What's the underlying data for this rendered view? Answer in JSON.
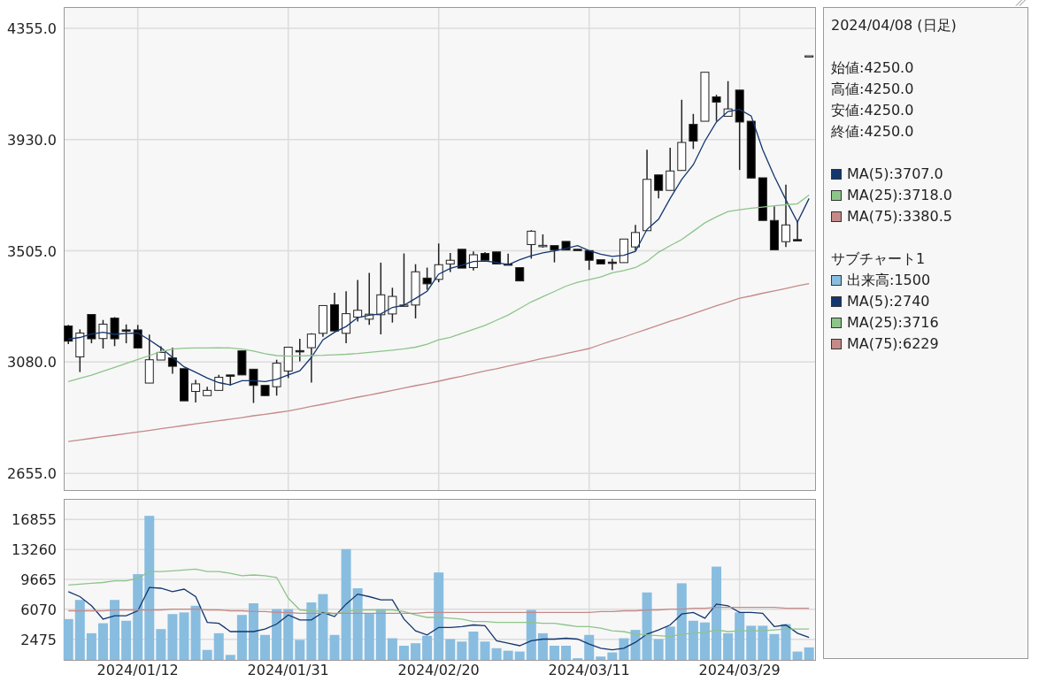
{
  "price_chart": {
    "chart_data": {
      "type": "candlestick",
      "grid": true,
      "ylim": [
        2588,
        4436
      ],
      "yticks": [
        {
          "value": 4355,
          "label": "4355.0"
        },
        {
          "value": 3930,
          "label": "3930.0"
        },
        {
          "value": 3505,
          "label": "3505.0"
        },
        {
          "value": 3080,
          "label": "3080.0"
        },
        {
          "value": 2655,
          "label": "2655.0"
        }
      ],
      "ohlc": [
        [
          3218,
          3222,
          3149,
          3160
        ],
        [
          3100,
          3205,
          3042,
          3191
        ],
        [
          3262,
          3262,
          3152,
          3169
        ],
        [
          3170,
          3241,
          3132,
          3225
        ],
        [
          3248,
          3252,
          3141,
          3169
        ],
        [
          3203,
          3224,
          3152,
          3200
        ],
        [
          3203,
          3222,
          3134,
          3134
        ],
        [
          3000,
          3185,
          3000,
          3089
        ],
        [
          3088,
          3140,
          3088,
          3117
        ],
        [
          3096,
          3135,
          3036,
          3064
        ],
        [
          3055,
          3055,
          2932,
          2932
        ],
        [
          2968,
          3012,
          2926,
          2997
        ],
        [
          2952,
          2986,
          2952,
          2972
        ],
        [
          2972,
          3031,
          2972,
          3022
        ],
        [
          3031,
          3031,
          2991,
          3029
        ],
        [
          3123,
          3123,
          3031,
          3031
        ],
        [
          3053,
          3053,
          2924,
          2991
        ],
        [
          2991,
          2991,
          2952,
          2952
        ],
        [
          2986,
          3089,
          2952,
          3076
        ],
        [
          3046,
          3137,
          3019,
          3137
        ],
        [
          3124,
          3169,
          3083,
          3123
        ],
        [
          3135,
          3190,
          3002,
          3187
        ],
        [
          3190,
          3296,
          3177,
          3296
        ],
        [
          3299,
          3345,
          3199,
          3199
        ],
        [
          3190,
          3351,
          3152,
          3265
        ],
        [
          3252,
          3394,
          3235,
          3278
        ],
        [
          3244,
          3421,
          3222,
          3263
        ],
        [
          3261,
          3460,
          3186,
          3337
        ],
        [
          3264,
          3364,
          3231,
          3331
        ],
        [
          3297,
          3495,
          3295,
          3298
        ],
        [
          3298,
          3454,
          3247,
          3425
        ],
        [
          3401,
          3441,
          3357,
          3379
        ],
        [
          3396,
          3533,
          3385,
          3452
        ],
        [
          3455,
          3497,
          3424,
          3469
        ],
        [
          3511,
          3511,
          3439,
          3439
        ],
        [
          3441,
          3503,
          3430,
          3490
        ],
        [
          3495,
          3500,
          3469,
          3469
        ],
        [
          3501,
          3501,
          3455,
          3455
        ],
        [
          3455,
          3494,
          3454,
          3454
        ],
        [
          3441,
          3441,
          3390,
          3390
        ],
        [
          3529,
          3584,
          3475,
          3580
        ],
        [
          3525,
          3568,
          3517,
          3526
        ],
        [
          3525,
          3525,
          3461,
          3508
        ],
        [
          3541,
          3541,
          3508,
          3508
        ],
        [
          3511,
          3511,
          3510,
          3510
        ],
        [
          3506,
          3506,
          3432,
          3469
        ],
        [
          3471,
          3471,
          3455,
          3455
        ],
        [
          3462,
          3475,
          3432,
          3461
        ],
        [
          3460,
          3550,
          3460,
          3550
        ],
        [
          3520,
          3604,
          3506,
          3575
        ],
        [
          3582,
          3891,
          3582,
          3778
        ],
        [
          3795,
          3795,
          3705,
          3736
        ],
        [
          3736,
          3899,
          3736,
          3810
        ],
        [
          3812,
          4082,
          3812,
          3919
        ],
        [
          3988,
          4028,
          3894,
          3924
        ],
        [
          4000,
          4187,
          4000,
          4187
        ],
        [
          4093,
          4101,
          4001,
          4073
        ],
        [
          4019,
          4153,
          4019,
          4047
        ],
        [
          4119,
          4119,
          3814,
          3997
        ],
        [
          4000,
          4000,
          3783,
          3783
        ],
        [
          3784,
          3784,
          3621,
          3621
        ],
        [
          3621,
          3675,
          3509,
          3509
        ],
        [
          3540,
          3758,
          3520,
          3604
        ],
        [
          3548,
          3615,
          3547,
          3547
        ],
        [
          4250,
          4250,
          4250,
          4250
        ]
      ],
      "series": [
        {
          "type": "line",
          "color": "#13366f",
          "values": [
            3168,
            3174,
            3187,
            3194,
            3186,
            3190,
            3191,
            3165,
            3135,
            3098,
            3062,
            3041,
            3019,
            3002,
            2993,
            3009,
            3009,
            3006,
            3014,
            3031,
            3047,
            3098,
            3165,
            3194,
            3216,
            3250,
            3259,
            3264,
            3289,
            3297,
            3323,
            3351,
            3416,
            3438,
            3450,
            3464,
            3466,
            3461,
            3452,
            3471,
            3486,
            3497,
            3505,
            3514,
            3525,
            3506,
            3492,
            3484,
            3488,
            3503,
            3587,
            3626,
            3705,
            3778,
            3834,
            3924,
            3997,
            4037,
            4045,
            4020,
            3891,
            3790,
            3700,
            3615,
            3705
          ]
        },
        {
          "type": "line",
          "color": "#8ec48a",
          "values": [
            3006,
            3018,
            3030,
            3045,
            3060,
            3075,
            3090,
            3105,
            3120,
            3130,
            3133,
            3134,
            3134,
            3135,
            3134,
            3130,
            3122,
            3112,
            3105,
            3103,
            3104,
            3105,
            3106,
            3108,
            3110,
            3113,
            3117,
            3121,
            3126,
            3131,
            3137,
            3148,
            3165,
            3175,
            3190,
            3205,
            3220,
            3240,
            3260,
            3285,
            3310,
            3330,
            3350,
            3370,
            3385,
            3395,
            3405,
            3421,
            3430,
            3441,
            3465,
            3500,
            3525,
            3548,
            3580,
            3612,
            3635,
            3655,
            3662,
            3668,
            3672,
            3677,
            3681,
            3685,
            3718
          ]
        },
        {
          "type": "line",
          "color": "#c48a88",
          "values": [
            2777,
            2783,
            2789,
            2795,
            2801,
            2807,
            2813,
            2819,
            2826,
            2832,
            2838,
            2844,
            2850,
            2856,
            2862,
            2868,
            2875,
            2881,
            2887,
            2893,
            2902,
            2911,
            2919,
            2928,
            2937,
            2946,
            2954,
            2963,
            2972,
            2981,
            2990,
            2998,
            3007,
            3017,
            3026,
            3036,
            3046,
            3055,
            3065,
            3074,
            3084,
            3094,
            3103,
            3113,
            3122,
            3132,
            3147,
            3162,
            3176,
            3191,
            3206,
            3221,
            3236,
            3250,
            3265,
            3280,
            3295,
            3309,
            3324,
            3333,
            3343,
            3352,
            3361,
            3371,
            3380
          ]
        }
      ]
    }
  },
  "volume_chart": {
    "chart_data": {
      "type": "bar",
      "grid": true,
      "ylim": [
        0,
        19335
      ],
      "categories": [
        null,
        null,
        null,
        null,
        null,
        null,
        "2024/01/12",
        null,
        null,
        null,
        null,
        null,
        null,
        null,
        null,
        null,
        null,
        null,
        null,
        "2024/01/31",
        null,
        null,
        null,
        null,
        null,
        null,
        null,
        null,
        null,
        null,
        null,
        null,
        "2024/02/20",
        null,
        null,
        null,
        null,
        null,
        null,
        null,
        null,
        null,
        null,
        null,
        null,
        "2024/03/11",
        null,
        null,
        null,
        null,
        null,
        null,
        null,
        null,
        null,
        null,
        null,
        null,
        "2024/03/29",
        null,
        null,
        null,
        null,
        null,
        null
      ],
      "yticks": [
        16855,
        13260,
        9665,
        6070,
        2475
      ],
      "series": [
        {
          "type": "bar",
          "color": "#88bde0",
          "values": [
            4900,
            7200,
            3200,
            4400,
            7200,
            4700,
            10300,
            17300,
            3700,
            5500,
            5700,
            6500,
            1200,
            3200,
            600,
            5400,
            6800,
            3000,
            6100,
            6100,
            2400,
            6900,
            7900,
            3000,
            13300,
            8600,
            5600,
            6100,
            2600,
            1700,
            2000,
            2900,
            10500,
            2500,
            2200,
            3400,
            2200,
            1400,
            1100,
            1000,
            6000,
            3200,
            1700,
            1700,
            200,
            3000,
            400,
            900,
            2600,
            3600,
            8100,
            2500,
            4000,
            9200,
            4700,
            4500,
            11200,
            3200,
            5700,
            4100,
            4100,
            3100,
            4300,
            1000,
            1500
          ]
        },
        {
          "type": "line",
          "color": "#13366f",
          "values": [
            8200,
            7600,
            6500,
            4900,
            5300,
            5300,
            5900,
            8700,
            8600,
            8200,
            8500,
            7600,
            4500,
            4400,
            3400,
            3400,
            3400,
            3700,
            4300,
            5400,
            4800,
            4800,
            5700,
            5200,
            6700,
            7900,
            7600,
            7200,
            7200,
            4900,
            3500,
            3000,
            3900,
            3900,
            4000,
            4200,
            4100,
            2300,
            2000,
            1700,
            2300,
            2500,
            2500,
            2600,
            2500,
            1900,
            1400,
            1200,
            1400,
            2100,
            3100,
            3600,
            4200,
            5500,
            5700,
            5000,
            6700,
            6500,
            5700,
            5700,
            5600,
            4000,
            4200,
            3200,
            2700
          ]
        },
        {
          "type": "line",
          "color": "#8ec48a",
          "values": [
            9000,
            9100,
            9200,
            9300,
            9500,
            9500,
            9800,
            10600,
            10600,
            10700,
            10800,
            10900,
            10600,
            10600,
            10400,
            10100,
            10200,
            10100,
            9900,
            7400,
            6000,
            5900,
            5800,
            5500,
            5800,
            6000,
            6000,
            6000,
            6000,
            5800,
            5400,
            5100,
            5100,
            5000,
            4900,
            4600,
            4600,
            4500,
            4500,
            4500,
            4500,
            4400,
            4400,
            4200,
            4000,
            4000,
            3800,
            3500,
            3400,
            3100,
            3000,
            2900,
            2800,
            3100,
            3200,
            3300,
            3600,
            3400,
            3500,
            3500,
            3500,
            3600,
            3700,
            3700,
            3700
          ]
        },
        {
          "type": "line",
          "color": "#c48a88",
          "values": [
            5900,
            5900,
            5900,
            5900,
            6000,
            6000,
            6000,
            6000,
            6000,
            6100,
            6100,
            6100,
            6000,
            6000,
            5900,
            5900,
            5800,
            5800,
            5700,
            5700,
            5600,
            5600,
            5600,
            5600,
            5600,
            5600,
            5600,
            5600,
            5600,
            5600,
            5600,
            5700,
            5700,
            5700,
            5700,
            5700,
            5700,
            5700,
            5700,
            5700,
            5700,
            5700,
            5700,
            5700,
            5700,
            5700,
            5800,
            5800,
            5900,
            5900,
            6000,
            6000,
            6100,
            6100,
            6200,
            6200,
            6300,
            6300,
            6300,
            6300,
            6300,
            6300,
            6200,
            6200,
            6200
          ]
        }
      ]
    }
  },
  "legend": {
    "date": "2024/04/08 (日足)",
    "ohlc": [
      "始値:4250.0",
      "高値:4250.0",
      "安値:4250.0",
      "終値:4250.0"
    ],
    "main_series": [
      {
        "label": "MA(5):3707.0",
        "color": "#13366f"
      },
      {
        "label": "MA(25):3718.0",
        "color": "#8ec48a"
      },
      {
        "label": "MA(75):3380.5",
        "color": "#c48a88"
      }
    ],
    "sub_title": "サブチャート1",
    "sub_series": [
      {
        "label": "出来高:1500",
        "color": "#88bde0"
      },
      {
        "label": "MA(5):2740",
        "color": "#13366f"
      },
      {
        "label": "MA(25):3716",
        "color": "#8ec48a"
      },
      {
        "label": "MA(75):6229",
        "color": "#c48a88"
      }
    ]
  }
}
